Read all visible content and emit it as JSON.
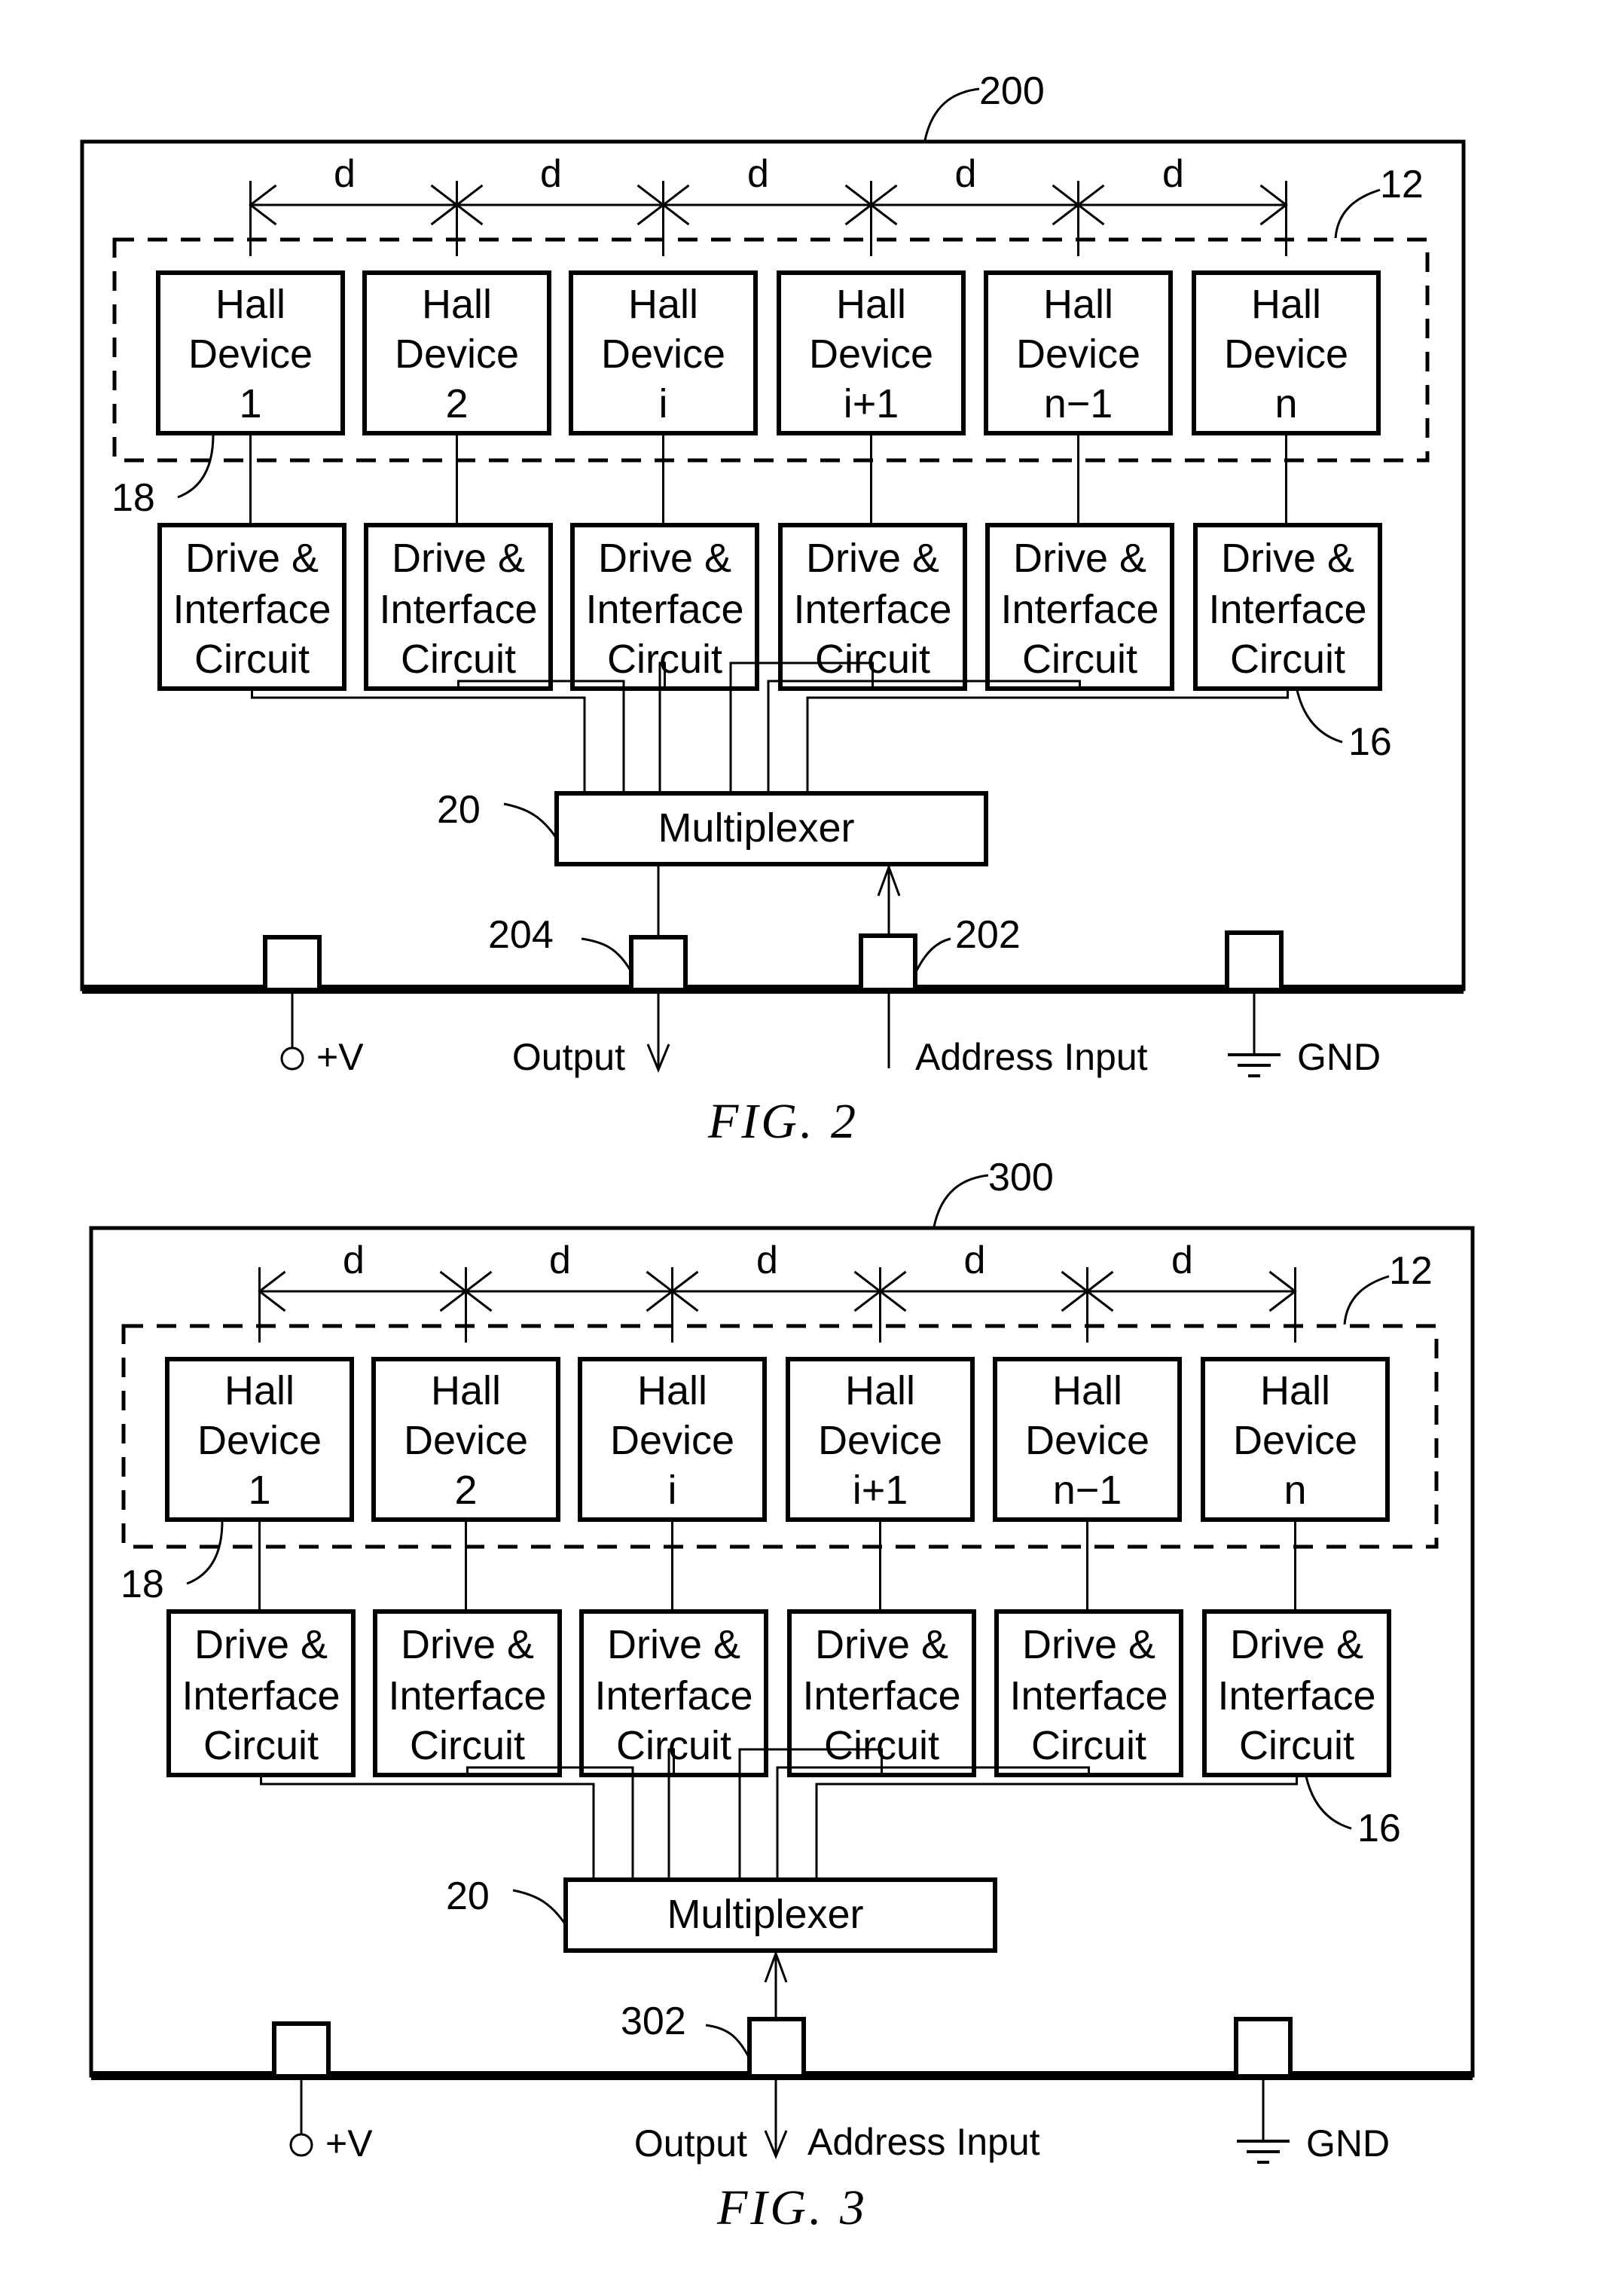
{
  "figures": [
    {
      "caption": "FIG. 2",
      "ref_chip": "200",
      "ref_array": "12",
      "ref_hall": "18",
      "ref_drive": "16",
      "ref_mux": "20",
      "spacing_label": "d",
      "hall_devices": [
        {
          "line1": "Hall",
          "line2": "Device",
          "line3": "1"
        },
        {
          "line1": "Hall",
          "line2": "Device",
          "line3": "2"
        },
        {
          "line1": "Hall",
          "line2": "Device",
          "line3": "i"
        },
        {
          "line1": "Hall",
          "line2": "Device",
          "line3": "i+1"
        },
        {
          "line1": "Hall",
          "line2": "Device",
          "line3": "n−1"
        },
        {
          "line1": "Hall",
          "line2": "Device",
          "line3": "n"
        }
      ],
      "drive_circuits": [
        {
          "line1": "Drive &",
          "line2": "Interface",
          "line3": "Circuit"
        },
        {
          "line1": "Drive &",
          "line2": "Interface",
          "line3": "Circuit"
        },
        {
          "line1": "Drive &",
          "line2": "Interface",
          "line3": "Circuit"
        },
        {
          "line1": "Drive &",
          "line2": "Interface",
          "line3": "Circuit"
        },
        {
          "line1": "Drive &",
          "line2": "Interface",
          "line3": "Circuit"
        },
        {
          "line1": "Drive &",
          "line2": "Interface",
          "line3": "Circuit"
        }
      ],
      "multiplexer_label": "Multiplexer",
      "pins": {
        "power": "+V",
        "output": "Output",
        "address": "Address Input",
        "ground": "GND",
        "ref_output_pin": "204",
        "ref_address_pin": "202"
      }
    },
    {
      "caption": "FIG. 3",
      "ref_chip": "300",
      "ref_array": "12",
      "ref_hall": "18",
      "ref_drive": "16",
      "ref_mux": "20",
      "spacing_label": "d",
      "hall_devices": [
        {
          "line1": "Hall",
          "line2": "Device",
          "line3": "1"
        },
        {
          "line1": "Hall",
          "line2": "Device",
          "line3": "2"
        },
        {
          "line1": "Hall",
          "line2": "Device",
          "line3": "i"
        },
        {
          "line1": "Hall",
          "line2": "Device",
          "line3": "i+1"
        },
        {
          "line1": "Hall",
          "line2": "Device",
          "line3": "n−1"
        },
        {
          "line1": "Hall",
          "line2": "Device",
          "line3": "n"
        }
      ],
      "drive_circuits": [
        {
          "line1": "Drive &",
          "line2": "Interface",
          "line3": "Circuit"
        },
        {
          "line1": "Drive &",
          "line2": "Interface",
          "line3": "Circuit"
        },
        {
          "line1": "Drive &",
          "line2": "Interface",
          "line3": "Circuit"
        },
        {
          "line1": "Drive &",
          "line2": "Interface",
          "line3": "Circuit"
        },
        {
          "line1": "Drive &",
          "line2": "Interface",
          "line3": "Circuit"
        },
        {
          "line1": "Drive &",
          "line2": "Interface",
          "line3": "Circuit"
        }
      ],
      "multiplexer_label": "Multiplexer",
      "pins": {
        "power": "+V",
        "output": "Output",
        "address": "Address Input",
        "ground": "GND",
        "ref_shared_pin": "302"
      }
    }
  ]
}
